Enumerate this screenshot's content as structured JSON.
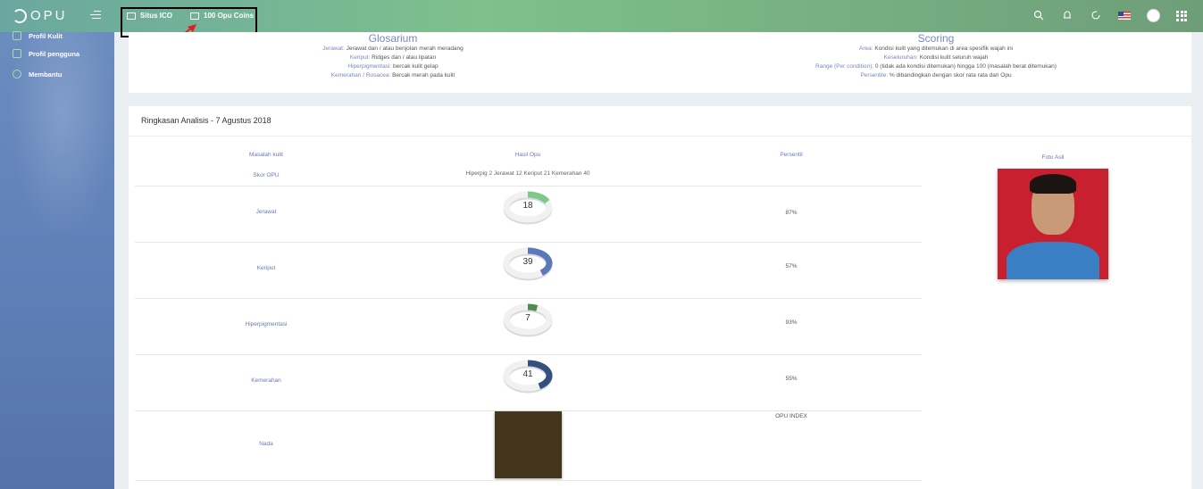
{
  "brand": "OPU",
  "topnav": {
    "items": [
      {
        "label": "Situs ICO"
      },
      {
        "label": "100 Opu Coins"
      }
    ]
  },
  "header_icons": [
    "search-icon",
    "bell-icon",
    "refresh-icon",
    "us-flag-icon",
    "avatar",
    "apps-grid-icon"
  ],
  "sidebar": {
    "items": [
      {
        "label": "Profil Kulit"
      },
      {
        "label": "Profil pengguna"
      },
      {
        "label": "Membantu"
      }
    ]
  },
  "glossary": {
    "title": "Glosarium",
    "lines": [
      {
        "key": "Jerawat:",
        "text": "Jerawat dan / atau benjolan merah meradang"
      },
      {
        "key": "Keriput:",
        "text": "Ridges dan / atau lipatan"
      },
      {
        "key": "Hiperpigmentasi:",
        "text": "bercak kulit gelap"
      },
      {
        "key": "Kemerahan / Rosacea:",
        "text": "Bercak merah pada kulit"
      }
    ]
  },
  "scoring": {
    "title": "Scoring",
    "lines": [
      {
        "key": "Area:",
        "text": "Kondisi kulit yang ditemukan di area spesifik wajah ini"
      },
      {
        "key": "Keseluruhan:",
        "text": "Kondisi kulit seluruh wajah"
      },
      {
        "key": "Range (Per condition):",
        "text": "0 (tidak ada kondisi ditemukan) hingga 100 (masalah berat ditemukan)"
      },
      {
        "key": "Persentile:",
        "text": "% dibandingkan dengan skor rata rata dari Opu"
      }
    ]
  },
  "analysis": {
    "title": "Ringkasan Analisis - 7 Agustus 2018",
    "columns": {
      "issue": "Masalah kulit",
      "result": "Hasil Opu",
      "percentile": "Persentil",
      "photo": "Foto Asli"
    },
    "score_label": "Skor OPU",
    "score_summary": "Hiperpig 2 Jerawat 12 Keriput 21 Kemerahan 40",
    "rows": [
      {
        "label": "Jerawat",
        "value": "18",
        "percentile": "87%",
        "color": "#7ec98a",
        "fraction": 0.18
      },
      {
        "label": "Keriput",
        "value": "39",
        "percentile": "57%",
        "color": "#5b78b8",
        "fraction": 0.39
      },
      {
        "label": "Hiperpigmentasi",
        "value": "7",
        "percentile": "93%",
        "color": "#4e8a52",
        "fraction": 0.07
      },
      {
        "label": "Kemerahan",
        "value": "41",
        "percentile": "55%",
        "color": "#34507f",
        "fraction": 0.41
      }
    ],
    "tone": {
      "label": "Nada",
      "index_label": "OPU INDEX",
      "color": "#43361d"
    }
  }
}
